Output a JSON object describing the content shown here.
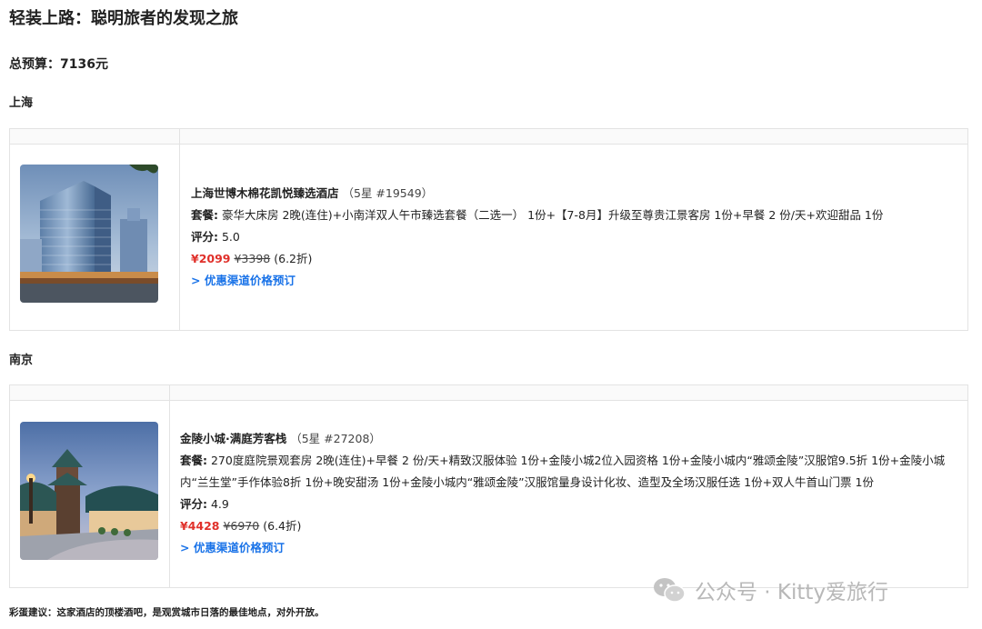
{
  "page": {
    "title": "轻装上路：聪明旅者的发现之旅",
    "budget": "总预算：7136元"
  },
  "cities": [
    {
      "name": "上海",
      "hotel": {
        "name": "上海世博木棉花凯悦臻选酒店",
        "stars": "（5星 #19549）",
        "package_label": "套餐:",
        "package": "豪华大床房 2晚(连住)+小南洋双人午市臻选套餐（二选一） 1份+【7-8月】升级至尊贵江景客房 1份+早餐 2 份/天+欢迎甜品 1份",
        "rating_label": "评分:",
        "rating": "5.0",
        "price": "¥2099",
        "orig_price": "¥3398",
        "discount": "(6.2折)",
        "link": "> 优惠渠道价格预订"
      }
    },
    {
      "name": "南京",
      "hotel": {
        "name": "金陵小城·满庭芳客栈",
        "stars": "（5星 #27208）",
        "package_label": "套餐:",
        "package": "270度庭院景观套房 2晚(连住)+早餐 2 份/天+精致汉服体验 1份+金陵小城2位入园资格 1份+金陵小城内“雅颂金陵”汉服馆9.5折 1份+金陵小城内“兰生堂”手作体验8折 1份+晚安甜汤 1份+金陵小城内“雅颂金陵”汉服馆量身设计化妆、造型及全场汉服任选 1份+双人牛首山门票 1份",
        "rating_label": "评分:",
        "rating": "4.9",
        "price": "¥4428",
        "orig_price": "¥6970",
        "discount": "(6.4折)",
        "link": "> 优惠渠道价格预订"
      }
    }
  ],
  "watermark": {
    "text": "公众号 · Kitty爱旅行",
    "icon": "wechat-icon"
  },
  "footer": {
    "tip": "彩蛋建议：这家酒店的顶楼酒吧，是观赏城市日落的最佳地点，对外开放。"
  }
}
